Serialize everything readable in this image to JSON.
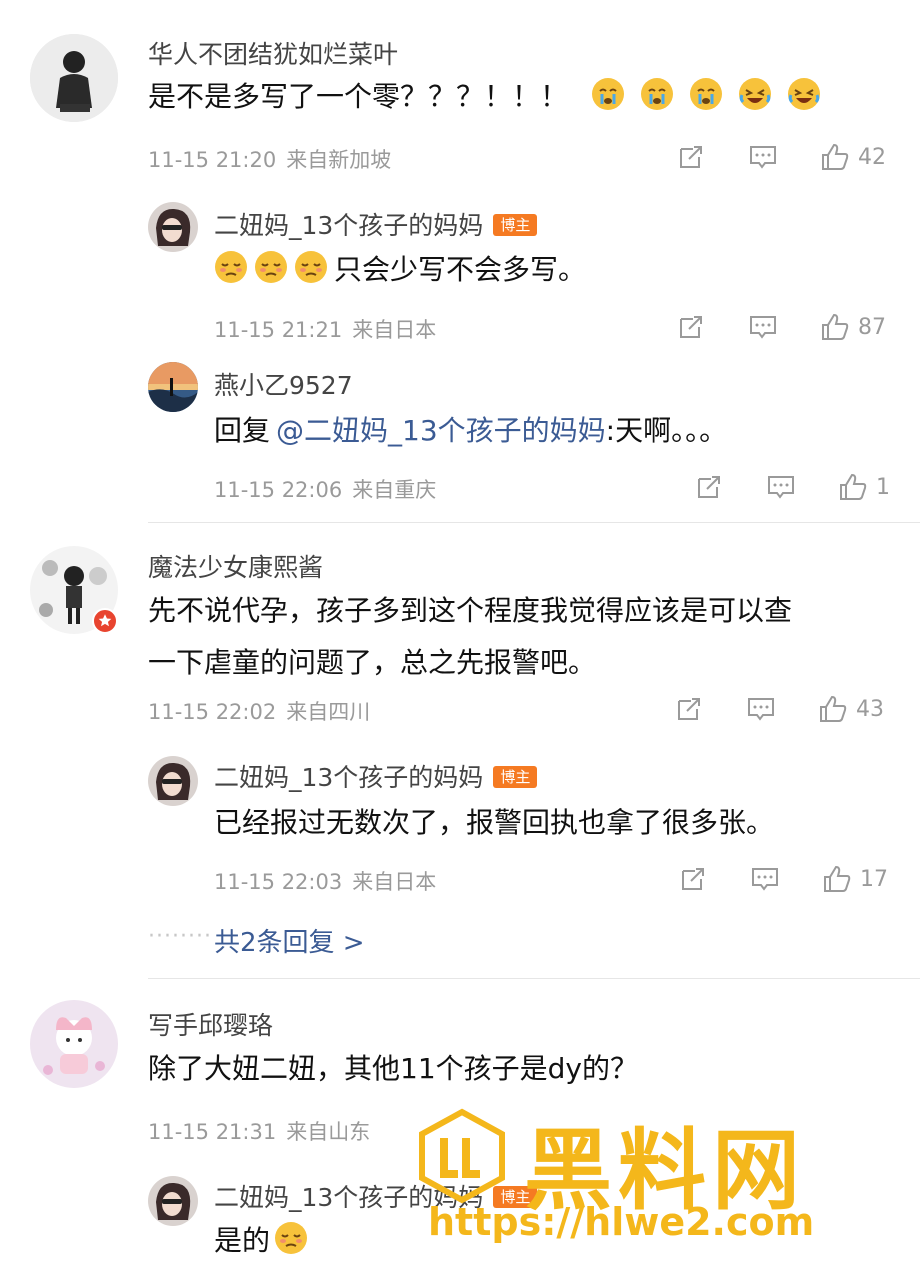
{
  "comments": [
    {
      "user": "华人不团结犹如烂菜叶",
      "text": "是不是多写了一个零？？？！！！",
      "date": "11-15 21:20",
      "location": "来自新加坡",
      "likes": "42",
      "replies": [
        {
          "user": "二妞妈_13个孩子的妈妈",
          "badge": "博主",
          "text_after": "只会少写不会多写。",
          "date": "11-15 21:21",
          "location": "来自日本",
          "likes": "87"
        },
        {
          "user": "燕小乙9527",
          "reply_prefix": "回复",
          "mention": "@二妞妈_13个孩子的妈妈",
          "text_after": ":天啊。。。",
          "date": "11-15 22:06",
          "location": "来自重庆",
          "likes": "1"
        }
      ]
    },
    {
      "user": "魔法少女康熙酱",
      "text_line1": "先不说代孕，孩子多到这个程度我觉得应该是可以查",
      "text_line2": "一下虐童的问题了，总之先报警吧。",
      "date": "11-15 22:02",
      "location": "来自四川",
      "likes": "43",
      "replies": [
        {
          "user": "二妞妈_13个孩子的妈妈",
          "badge": "博主",
          "text": "已经报过无数次了，报警回执也拿了很多张。",
          "date": "11-15 22:03",
          "location": "来自日本",
          "likes": "17"
        }
      ],
      "more_replies": "共2条回复 >"
    },
    {
      "user": "写手邱璎珞",
      "text": "除了大妞二妞，其他11个孩子是dy的？",
      "date": "11-15 21:31",
      "location": "来自山东",
      "replies": [
        {
          "user": "二妞妈_13个孩子的妈妈",
          "badge": "博主",
          "text": "是的"
        }
      ]
    }
  ],
  "watermark": {
    "title": "黑料网",
    "url": "https://hlwe2.com"
  },
  "colors": {
    "accent_link": "#3b5b94",
    "badge": "#f57a22",
    "watermark": "#f4b71b"
  }
}
